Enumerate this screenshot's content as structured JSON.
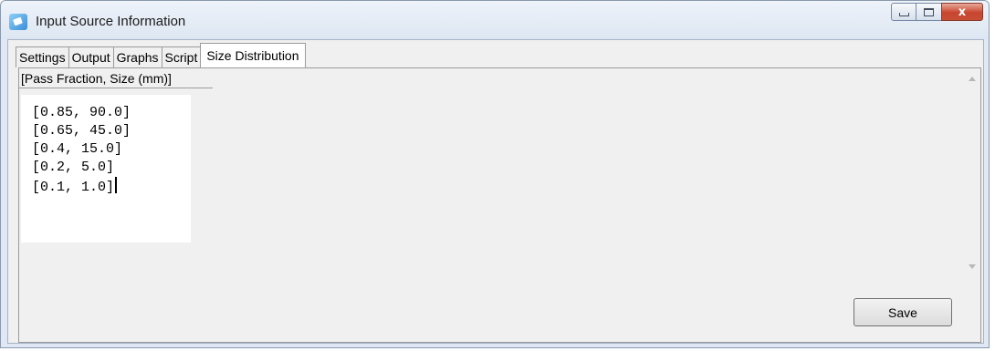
{
  "window": {
    "title": "Input Source Information",
    "close_glyph": "x"
  },
  "tabs": [
    {
      "label": "Settings",
      "active": false
    },
    {
      "label": "Output",
      "active": false
    },
    {
      "label": "Graphs",
      "active": false
    },
    {
      "label": "Script",
      "active": false
    },
    {
      "label": "Size Distribution",
      "active": true
    }
  ],
  "panel": {
    "header_label": "[Pass Fraction, Size (mm)]",
    "lines": [
      "[0.85, 90.0]",
      "[0.65, 45.0]",
      "[0.4, 15.0]",
      "[0.2, 5.0]",
      "[0.1, 1.0]"
    ],
    "save_label": "Save"
  },
  "icons": {
    "app": "app-window-icon",
    "minimize": "minimize-icon",
    "maximize": "maximize-icon",
    "close": "close-icon",
    "scroll_up": "scroll-up-arrow-icon",
    "scroll_down": "scroll-down-arrow-icon"
  },
  "colors": {
    "titlebar": "#dde6f2",
    "close_button": "#c8452f",
    "client_bg": "#f0f0f0"
  }
}
